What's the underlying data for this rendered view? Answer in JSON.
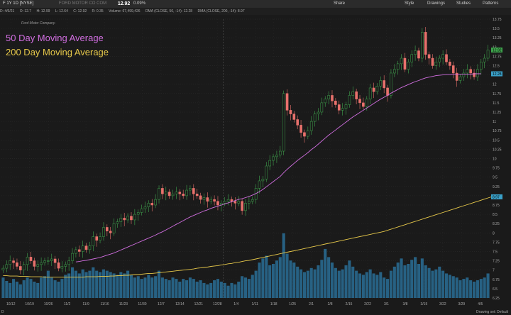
{
  "toolbar": {
    "symbol": "F 1Y 1D [NYSE]",
    "company": "FORD MOTOR CO COM",
    "price": "12.92",
    "change": "0.09%",
    "buttons": [
      "Share",
      "Style",
      "Drawings",
      "Studies",
      "Patterns"
    ]
  },
  "statusbar": {
    "items": [
      "D: 4/6/21",
      "O: 12.7",
      "H: 12.99",
      "L: 12.64",
      "C: 12.92",
      "R: 0.35",
      "Volume: 67,499,426",
      "DMA (CLOSE, 50, -14): 12.28",
      "DMA (CLOSE, 200, -14): 8.97"
    ]
  },
  "legend": {
    "ma50": "50 Day Moving Average",
    "ma200": "200 Day Moving Average"
  },
  "signature": "Ford Motor Company.",
  "bottom": {
    "drawing_set": "Drawing set: Default",
    "timeframe": "D"
  },
  "colors": {
    "up": "#3fa34d",
    "down": "#e8716c",
    "ma50": "#d16ee0",
    "ma200": "#e6c84a",
    "volume": "#2a6f97",
    "grid": "#2e2e2e"
  },
  "chart_data": {
    "type": "candlestick",
    "ylim": [
      6.25,
      13.75
    ],
    "y_ticks": [
      "13.75",
      "13.5",
      "13.25",
      "13",
      "12.75",
      "12.5",
      "12.25",
      "12",
      "11.75",
      "11.5",
      "11.25",
      "11",
      "10.75",
      "10.5",
      "10.25",
      "10",
      "9.75",
      "9.5",
      "9.25",
      "9",
      "8.75",
      "8.5",
      "8.25",
      "8",
      "7.75",
      "7.5",
      "7.25",
      "7",
      "6.75",
      "6.5",
      "6.25"
    ],
    "x_ticks": [
      "10/12",
      "10/19",
      "10/26",
      "11/2",
      "11/9",
      "11/16",
      "11/23",
      "11/30",
      "12/7",
      "12/14",
      "12/21",
      "12/28",
      "1/4",
      "1/11",
      "1/18",
      "1/25",
      "2/1",
      "2/8",
      "2/15",
      "2/22",
      "3/1",
      "3/8",
      "3/15",
      "3/22",
      "3/29",
      "4/5"
    ],
    "close": [
      7.05,
      7.15,
      7.25,
      7.2,
      7.1,
      7.0,
      7.15,
      7.35,
      7.25,
      7.1,
      7.15,
      7.2,
      7.25,
      7.25,
      7.3,
      7.2,
      7.05,
      7.1,
      7.15,
      7.25,
      7.45,
      7.55,
      7.5,
      7.65,
      7.55,
      7.65,
      7.9,
      7.8,
      7.9,
      8.15,
      8.05,
      8.0,
      8.25,
      8.3,
      8.4,
      8.35,
      8.45,
      8.35,
      8.5,
      8.55,
      8.65,
      8.7,
      8.8,
      8.75,
      8.9,
      9.2,
      9.05,
      9.1,
      9.0,
      9.05,
      9.1,
      9.05,
      9.0,
      9.15,
      9.2,
      9.05,
      9.0,
      8.9,
      8.95,
      8.85,
      8.9,
      8.85,
      8.75,
      8.8,
      8.85,
      8.9,
      8.85,
      8.8,
      8.85,
      8.6,
      8.8,
      8.85,
      8.9,
      9.2,
      9.4,
      9.45,
      9.8,
      9.95,
      10.05,
      10.1,
      10.2,
      11.75,
      11.3,
      11.2,
      11.05,
      10.9,
      10.7,
      10.6,
      10.75,
      11.0,
      11.2,
      11.25,
      11.5,
      11.6,
      11.7,
      11.55,
      11.45,
      11.3,
      11.35,
      11.45,
      11.7,
      11.8,
      11.6,
      11.5,
      11.4,
      11.6,
      11.9,
      11.8,
      11.95,
      12.1,
      11.9,
      11.7,
      12.3,
      12.4,
      12.55,
      12.7,
      12.4,
      12.6,
      12.8,
      12.9,
      12.7,
      13.4,
      12.8,
      12.7,
      12.5,
      12.6,
      12.7,
      12.8,
      12.6,
      12.5,
      12.3,
      12.1,
      12.2,
      12.3,
      12.4,
      12.3,
      12.2,
      12.4,
      12.6,
      12.7,
      12.92
    ],
    "ma50": [
      null,
      null,
      null,
      null,
      null,
      null,
      null,
      null,
      null,
      null,
      null,
      null,
      null,
      null,
      null,
      null,
      null,
      null,
      null,
      null,
      null,
      7.22,
      7.23,
      7.25,
      7.26,
      7.28,
      7.3,
      7.32,
      7.34,
      7.37,
      7.4,
      7.43,
      7.46,
      7.5,
      7.54,
      7.58,
      7.62,
      7.66,
      7.7,
      7.74,
      7.78,
      7.82,
      7.86,
      7.9,
      7.94,
      7.99,
      8.03,
      8.08,
      8.13,
      8.18,
      8.23,
      8.28,
      8.33,
      8.38,
      8.43,
      8.47,
      8.51,
      8.55,
      8.59,
      8.62,
      8.66,
      8.69,
      8.72,
      8.75,
      8.78,
      8.81,
      8.84,
      8.87,
      8.9,
      8.92,
      8.95,
      8.98,
      9.02,
      9.06,
      9.11,
      9.17,
      9.24,
      9.31,
      9.38,
      9.45,
      9.52,
      9.62,
      9.71,
      9.79,
      9.87,
      9.95,
      10.02,
      10.09,
      10.16,
      10.24,
      10.31,
      10.39,
      10.47,
      10.55,
      10.63,
      10.7,
      10.77,
      10.84,
      10.91,
      10.98,
      11.05,
      11.12,
      11.18,
      11.24,
      11.3,
      11.36,
      11.42,
      11.48,
      11.54,
      11.6,
      11.65,
      11.7,
      11.76,
      11.81,
      11.86,
      11.91,
      11.95,
      11.99,
      12.03,
      12.07,
      12.1,
      12.14,
      12.17,
      12.19,
      12.21,
      12.23,
      12.24,
      12.25,
      12.26,
      12.26,
      12.27,
      12.27,
      12.27,
      12.27,
      12.27,
      12.27,
      12.28,
      12.28,
      12.28
    ],
    "ma200": [
      6.85,
      6.85,
      6.84,
      6.84,
      6.84,
      6.83,
      6.83,
      6.83,
      6.82,
      6.82,
      6.82,
      6.82,
      6.81,
      6.81,
      6.81,
      6.81,
      6.81,
      6.81,
      6.81,
      6.81,
      6.81,
      6.81,
      6.81,
      6.81,
      6.82,
      6.82,
      6.82,
      6.82,
      6.83,
      6.83,
      6.83,
      6.84,
      6.84,
      6.85,
      6.85,
      6.86,
      6.86,
      6.87,
      6.88,
      6.88,
      6.89,
      6.9,
      6.91,
      6.91,
      6.92,
      6.93,
      6.94,
      6.95,
      6.96,
      6.97,
      6.98,
      6.99,
      7.0,
      7.01,
      7.02,
      7.03,
      7.05,
      7.06,
      7.07,
      7.08,
      7.1,
      7.11,
      7.12,
      7.14,
      7.15,
      7.17,
      7.18,
      7.2,
      7.21,
      7.23,
      7.25,
      7.26,
      7.28,
      7.3,
      7.32,
      7.34,
      7.36,
      7.38,
      7.4,
      7.42,
      7.44,
      7.46,
      7.48,
      7.5,
      7.52,
      7.54,
      7.56,
      7.58,
      7.6,
      7.62,
      7.64,
      7.66,
      7.68,
      7.7,
      7.72,
      7.74,
      7.76,
      7.78,
      7.8,
      7.82,
      7.84,
      7.86,
      7.88,
      7.9,
      7.92,
      7.94,
      7.96,
      7.98,
      8.0,
      8.02,
      8.04,
      8.07,
      8.1,
      8.13,
      8.16,
      8.19,
      8.22,
      8.25,
      8.28,
      8.31,
      8.34,
      8.37,
      8.4,
      8.43,
      8.46,
      8.49,
      8.52,
      8.55,
      8.58,
      8.61,
      8.64,
      8.67,
      8.7,
      8.73,
      8.76,
      8.79,
      8.82,
      8.85,
      8.88,
      8.91,
      8.94,
      8.97
    ],
    "volume": [
      0.3,
      0.25,
      0.22,
      0.28,
      0.24,
      0.2,
      0.26,
      0.3,
      0.28,
      0.24,
      0.22,
      0.3,
      0.32,
      0.4,
      0.3,
      0.26,
      0.24,
      0.28,
      0.34,
      0.36,
      0.45,
      0.4,
      0.36,
      0.42,
      0.38,
      0.4,
      0.45,
      0.4,
      0.38,
      0.42,
      0.4,
      0.38,
      0.36,
      0.34,
      0.38,
      0.36,
      0.4,
      0.34,
      0.3,
      0.32,
      0.28,
      0.3,
      0.34,
      0.3,
      0.32,
      0.4,
      0.3,
      0.28,
      0.26,
      0.3,
      0.28,
      0.24,
      0.28,
      0.26,
      0.3,
      0.28,
      0.24,
      0.26,
      0.22,
      0.2,
      0.22,
      0.26,
      0.28,
      0.24,
      0.22,
      0.18,
      0.22,
      0.2,
      0.24,
      0.32,
      0.3,
      0.28,
      0.34,
      0.4,
      0.52,
      0.58,
      0.62,
      0.48,
      0.5,
      0.55,
      0.6,
      0.95,
      0.65,
      0.55,
      0.52,
      0.46,
      0.42,
      0.38,
      0.4,
      0.44,
      0.42,
      0.48,
      0.56,
      0.72,
      0.6,
      0.52,
      0.44,
      0.4,
      0.42,
      0.48,
      0.55,
      0.46,
      0.4,
      0.36,
      0.34,
      0.38,
      0.42,
      0.36,
      0.34,
      0.38,
      0.3,
      0.28,
      0.4,
      0.46,
      0.52,
      0.58,
      0.48,
      0.5,
      0.56,
      0.6,
      0.5,
      0.58,
      0.48,
      0.44,
      0.4,
      0.42,
      0.46,
      0.4,
      0.36,
      0.34,
      0.32,
      0.3,
      0.26,
      0.28,
      0.3,
      0.26,
      0.24,
      0.26,
      0.28,
      0.3,
      0.36
    ],
    "current_price_label": "12.92",
    "ma50_label": "12.28",
    "ma200_label": "8.97"
  }
}
